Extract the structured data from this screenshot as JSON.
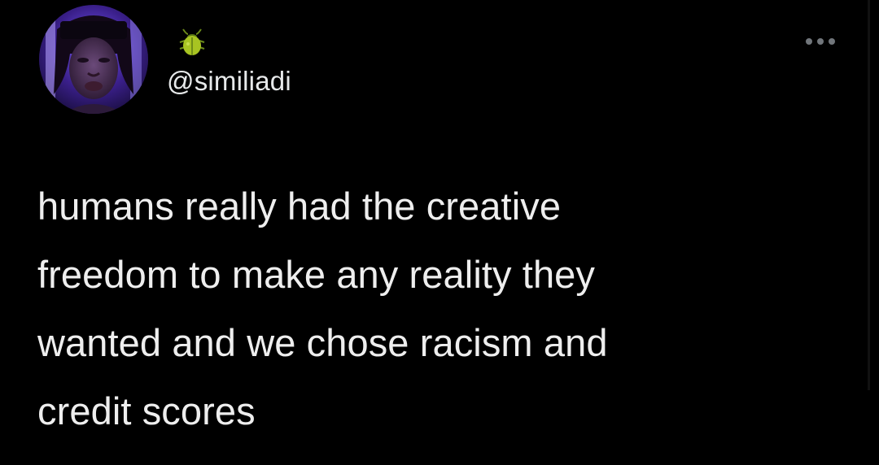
{
  "tweet": {
    "handle": "@similiadi",
    "display_name_icon": "beetle-emoji-icon",
    "more_icon": "more-horizontal-icon",
    "text_lines": [
      "humans really had the creative",
      "freedom to make any reality they",
      "wanted and we chose racism and",
      "credit scores"
    ]
  },
  "colors": {
    "background": "#000000",
    "text": "#e7e9ea",
    "icon_muted": "#71767b",
    "beetle": "#a8c422"
  }
}
